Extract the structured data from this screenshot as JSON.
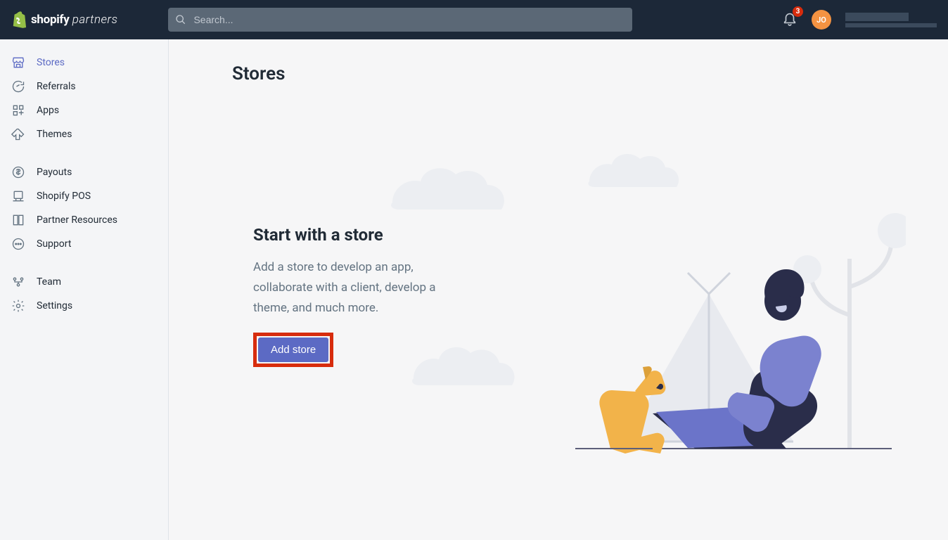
{
  "header": {
    "logo_bold": "shopify",
    "logo_light": "partners",
    "search_placeholder": "Search...",
    "notification_count": "3",
    "avatar_initials": "JO"
  },
  "sidebar": {
    "group1": [
      {
        "label": "Stores",
        "active": true
      },
      {
        "label": "Referrals"
      },
      {
        "label": "Apps"
      },
      {
        "label": "Themes"
      }
    ],
    "group2": [
      {
        "label": "Payouts"
      },
      {
        "label": "Shopify POS"
      },
      {
        "label": "Partner Resources"
      },
      {
        "label": "Support"
      }
    ],
    "group3": [
      {
        "label": "Team"
      },
      {
        "label": "Settings"
      }
    ]
  },
  "page": {
    "title": "Stores",
    "empty_title": "Start with a store",
    "empty_text": "Add a store to develop an app, collaborate with a client, develop a theme, and much more.",
    "add_button": "Add store"
  }
}
